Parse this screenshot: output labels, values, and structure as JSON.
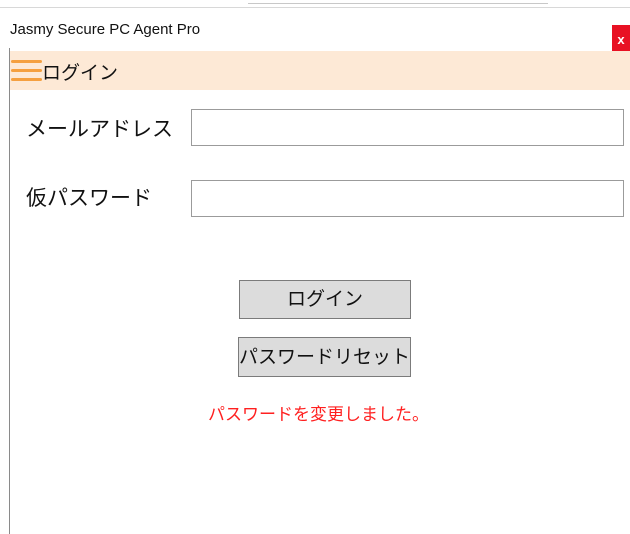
{
  "window": {
    "title": "Jasmy Secure PC Agent Pro",
    "close_label": "x"
  },
  "header": {
    "menu_icon": "hamburger-menu-icon",
    "title": "ログイン",
    "background_color": "#fde9d6",
    "accent_color": "#f5a040"
  },
  "form": {
    "email": {
      "label": "メールアドレス",
      "value": "",
      "placeholder": ""
    },
    "temp_password": {
      "label": "仮パスワード",
      "value": "",
      "placeholder": ""
    }
  },
  "actions": {
    "login_label": "ログイン",
    "reset_label": "パスワードリセット"
  },
  "status": {
    "message": "パスワードを変更しました。",
    "color": "#ff2020"
  }
}
